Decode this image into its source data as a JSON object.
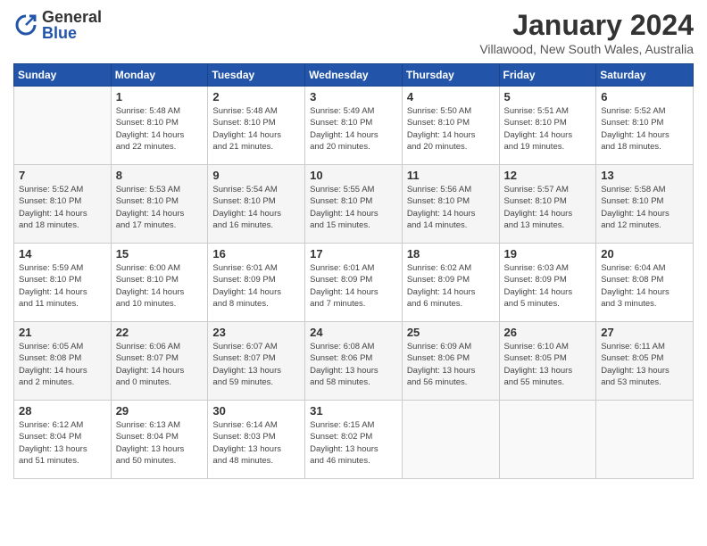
{
  "logo": {
    "general": "General",
    "blue": "Blue"
  },
  "title": "January 2024",
  "subtitle": "Villawood, New South Wales, Australia",
  "weekdays": [
    "Sunday",
    "Monday",
    "Tuesday",
    "Wednesday",
    "Thursday",
    "Friday",
    "Saturday"
  ],
  "weeks": [
    [
      {
        "day": "",
        "info": ""
      },
      {
        "day": "1",
        "info": "Sunrise: 5:48 AM\nSunset: 8:10 PM\nDaylight: 14 hours\nand 22 minutes."
      },
      {
        "day": "2",
        "info": "Sunrise: 5:48 AM\nSunset: 8:10 PM\nDaylight: 14 hours\nand 21 minutes."
      },
      {
        "day": "3",
        "info": "Sunrise: 5:49 AM\nSunset: 8:10 PM\nDaylight: 14 hours\nand 20 minutes."
      },
      {
        "day": "4",
        "info": "Sunrise: 5:50 AM\nSunset: 8:10 PM\nDaylight: 14 hours\nand 20 minutes."
      },
      {
        "day": "5",
        "info": "Sunrise: 5:51 AM\nSunset: 8:10 PM\nDaylight: 14 hours\nand 19 minutes."
      },
      {
        "day": "6",
        "info": "Sunrise: 5:52 AM\nSunset: 8:10 PM\nDaylight: 14 hours\nand 18 minutes."
      }
    ],
    [
      {
        "day": "7",
        "info": "Sunrise: 5:52 AM\nSunset: 8:10 PM\nDaylight: 14 hours\nand 18 minutes."
      },
      {
        "day": "8",
        "info": "Sunrise: 5:53 AM\nSunset: 8:10 PM\nDaylight: 14 hours\nand 17 minutes."
      },
      {
        "day": "9",
        "info": "Sunrise: 5:54 AM\nSunset: 8:10 PM\nDaylight: 14 hours\nand 16 minutes."
      },
      {
        "day": "10",
        "info": "Sunrise: 5:55 AM\nSunset: 8:10 PM\nDaylight: 14 hours\nand 15 minutes."
      },
      {
        "day": "11",
        "info": "Sunrise: 5:56 AM\nSunset: 8:10 PM\nDaylight: 14 hours\nand 14 minutes."
      },
      {
        "day": "12",
        "info": "Sunrise: 5:57 AM\nSunset: 8:10 PM\nDaylight: 14 hours\nand 13 minutes."
      },
      {
        "day": "13",
        "info": "Sunrise: 5:58 AM\nSunset: 8:10 PM\nDaylight: 14 hours\nand 12 minutes."
      }
    ],
    [
      {
        "day": "14",
        "info": "Sunrise: 5:59 AM\nSunset: 8:10 PM\nDaylight: 14 hours\nand 11 minutes."
      },
      {
        "day": "15",
        "info": "Sunrise: 6:00 AM\nSunset: 8:10 PM\nDaylight: 14 hours\nand 10 minutes."
      },
      {
        "day": "16",
        "info": "Sunrise: 6:01 AM\nSunset: 8:09 PM\nDaylight: 14 hours\nand 8 minutes."
      },
      {
        "day": "17",
        "info": "Sunrise: 6:01 AM\nSunset: 8:09 PM\nDaylight: 14 hours\nand 7 minutes."
      },
      {
        "day": "18",
        "info": "Sunrise: 6:02 AM\nSunset: 8:09 PM\nDaylight: 14 hours\nand 6 minutes."
      },
      {
        "day": "19",
        "info": "Sunrise: 6:03 AM\nSunset: 8:09 PM\nDaylight: 14 hours\nand 5 minutes."
      },
      {
        "day": "20",
        "info": "Sunrise: 6:04 AM\nSunset: 8:08 PM\nDaylight: 14 hours\nand 3 minutes."
      }
    ],
    [
      {
        "day": "21",
        "info": "Sunrise: 6:05 AM\nSunset: 8:08 PM\nDaylight: 14 hours\nand 2 minutes."
      },
      {
        "day": "22",
        "info": "Sunrise: 6:06 AM\nSunset: 8:07 PM\nDaylight: 14 hours\nand 0 minutes."
      },
      {
        "day": "23",
        "info": "Sunrise: 6:07 AM\nSunset: 8:07 PM\nDaylight: 13 hours\nand 59 minutes."
      },
      {
        "day": "24",
        "info": "Sunrise: 6:08 AM\nSunset: 8:06 PM\nDaylight: 13 hours\nand 58 minutes."
      },
      {
        "day": "25",
        "info": "Sunrise: 6:09 AM\nSunset: 8:06 PM\nDaylight: 13 hours\nand 56 minutes."
      },
      {
        "day": "26",
        "info": "Sunrise: 6:10 AM\nSunset: 8:05 PM\nDaylight: 13 hours\nand 55 minutes."
      },
      {
        "day": "27",
        "info": "Sunrise: 6:11 AM\nSunset: 8:05 PM\nDaylight: 13 hours\nand 53 minutes."
      }
    ],
    [
      {
        "day": "28",
        "info": "Sunrise: 6:12 AM\nSunset: 8:04 PM\nDaylight: 13 hours\nand 51 minutes."
      },
      {
        "day": "29",
        "info": "Sunrise: 6:13 AM\nSunset: 8:04 PM\nDaylight: 13 hours\nand 50 minutes."
      },
      {
        "day": "30",
        "info": "Sunrise: 6:14 AM\nSunset: 8:03 PM\nDaylight: 13 hours\nand 48 minutes."
      },
      {
        "day": "31",
        "info": "Sunrise: 6:15 AM\nSunset: 8:02 PM\nDaylight: 13 hours\nand 46 minutes."
      },
      {
        "day": "",
        "info": ""
      },
      {
        "day": "",
        "info": ""
      },
      {
        "day": "",
        "info": ""
      }
    ]
  ]
}
